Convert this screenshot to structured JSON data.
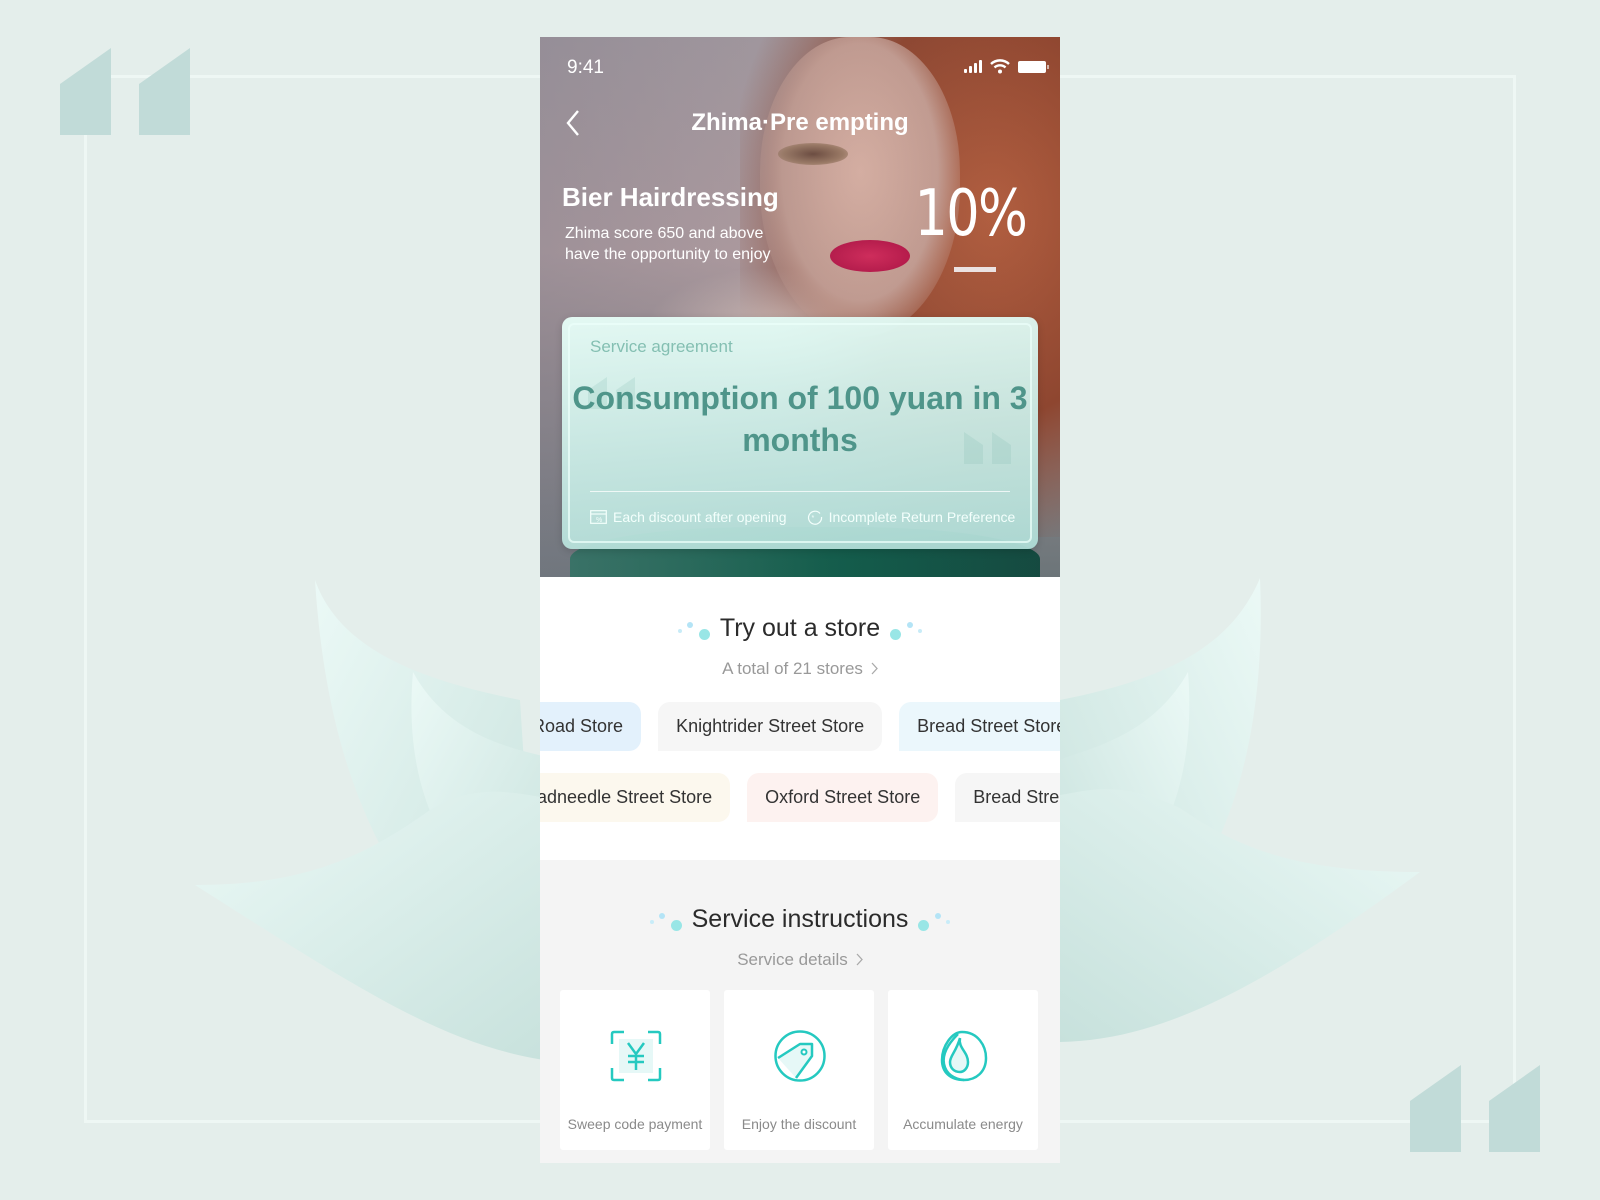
{
  "status_bar": {
    "time": "9:41",
    "icons": [
      "signal-icon",
      "wifi-icon",
      "battery-icon"
    ]
  },
  "nav": {
    "back_icon": "chevron-left-icon",
    "title": "Zhima·Pre empting"
  },
  "promo": {
    "merchant": "Bier Hairdressing",
    "description": "Zhima score 650 and above have the opportunity to enjoy",
    "discount": "10%"
  },
  "agreement": {
    "label": "Service agreement",
    "headline": "Consumption of 100 yuan in 3 months",
    "features": [
      {
        "icon": "discount-card-icon",
        "label": "Each discount after opening"
      },
      {
        "icon": "refund-cycle-icon",
        "label": "Incomplete Return Preference"
      }
    ]
  },
  "stores": {
    "title": "Try out a store",
    "subtitle": "A total of 21 stores",
    "row1": [
      {
        "label": "Road Store",
        "color": "#e3f1fc"
      },
      {
        "label": "Knightrider Street Store",
        "color": "#f6f6f6"
      },
      {
        "label": "Bread Street Store",
        "color": "#ebf7fc"
      }
    ],
    "row2": [
      {
        "label": "Threadneedle Street Store",
        "color": "#fcf8ee"
      },
      {
        "label": "Oxford Street Store",
        "color": "#fdf2f0"
      },
      {
        "label": "Bread Street Store",
        "color": "#f6f6f6"
      }
    ]
  },
  "service": {
    "title": "Service instructions",
    "subtitle": "Service details",
    "cards": [
      {
        "icon": "scan-pay-icon",
        "label": "Sweep code payment"
      },
      {
        "icon": "discount-tag-icon",
        "label": "Enjoy the discount"
      },
      {
        "icon": "energy-drop-icon",
        "label": "Accumulate energy"
      }
    ]
  },
  "colors": {
    "accent": "#25c9c0",
    "headline": "#4f958a",
    "background": "#e4eeeb"
  }
}
